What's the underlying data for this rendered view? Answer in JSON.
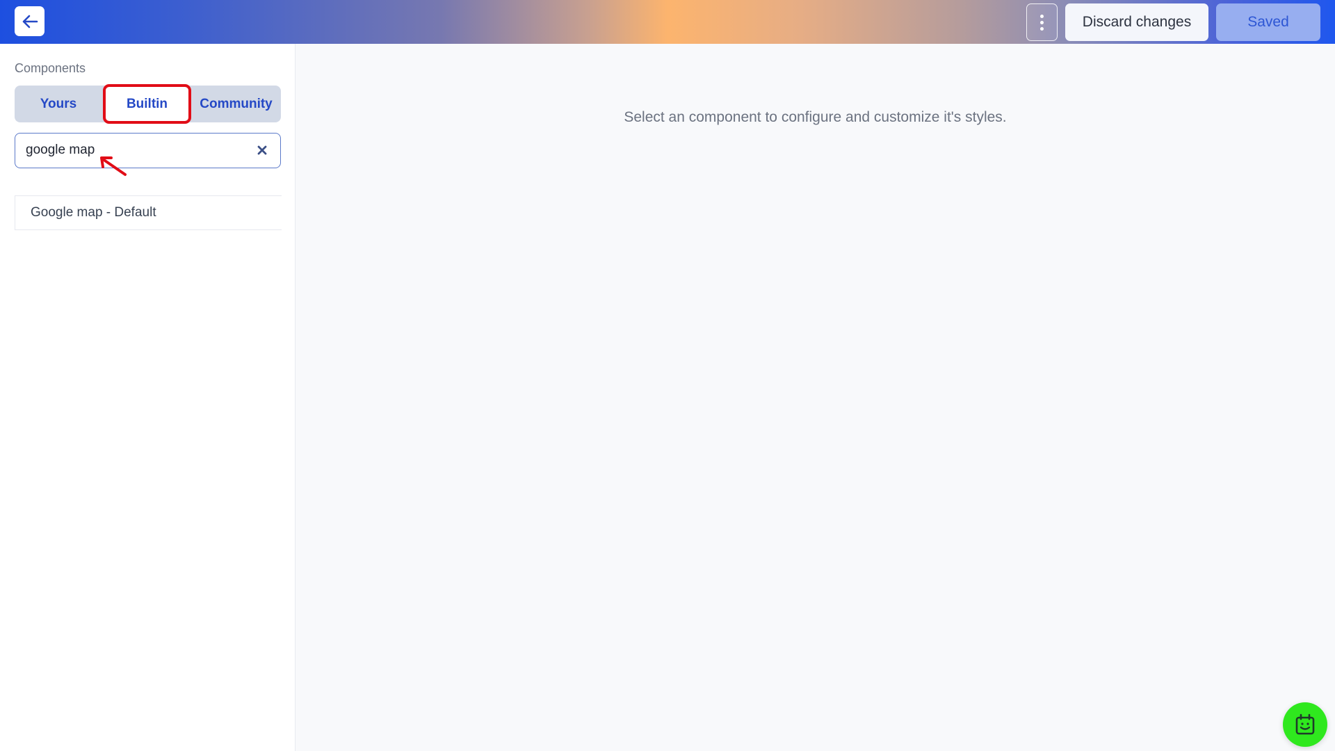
{
  "header": {
    "back_icon": "arrow-left-icon",
    "more_icon": "vertical-dots-icon",
    "discard_label": "Discard changes",
    "saved_label": "Saved"
  },
  "sidebar": {
    "section_title": "Components",
    "tabs": [
      {
        "label": "Yours",
        "active": false
      },
      {
        "label": "Builtin",
        "active": true,
        "highlighted": true
      },
      {
        "label": "Community",
        "active": false
      }
    ],
    "search": {
      "value": "google map",
      "placeholder": "",
      "clear_icon": "close-icon"
    },
    "results": [
      {
        "label": "Google map - Default"
      }
    ]
  },
  "main": {
    "empty_message": "Select an component to configure and customize it's styles."
  },
  "colors": {
    "accent": "#2549c6",
    "highlight": "#e10d17",
    "fab": "#2fe81e"
  },
  "fab": {
    "icon": "calendar-smile-icon"
  }
}
